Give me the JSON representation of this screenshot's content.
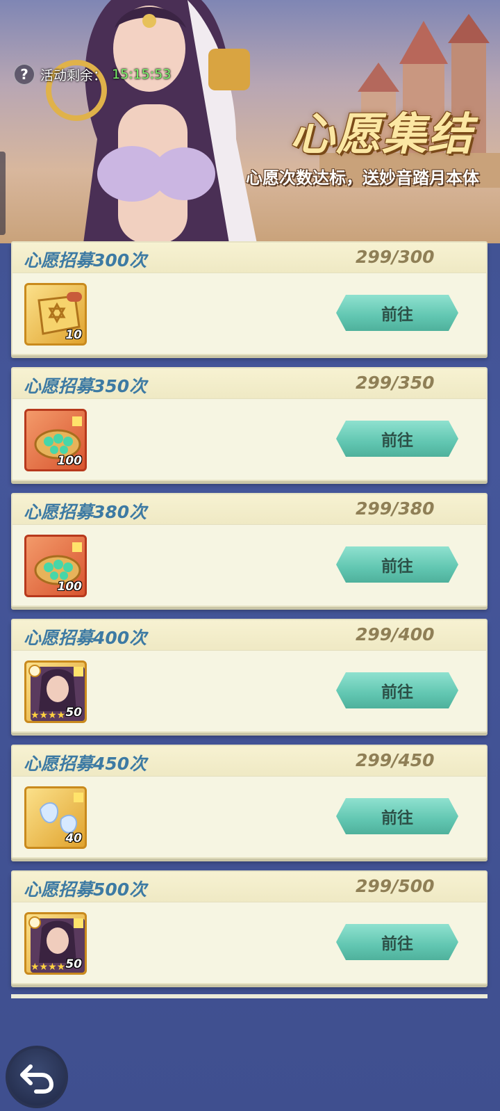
{
  "banner": {
    "timer_label": "活动剩余：",
    "timer_value": "15:15:53",
    "title": "心愿集结",
    "subtitle": "心愿次数达标，送妙音踏月本体"
  },
  "tasks": [
    {
      "name": "心愿招募300次",
      "progress": "299/300",
      "reward_icon": "scroll-icon",
      "quantity": "10",
      "button": "前往"
    },
    {
      "name": "心愿招募350次",
      "progress": "299/350",
      "reward_icon": "jade-gem-icon",
      "quantity": "100",
      "button": "前往"
    },
    {
      "name": "心愿招募380次",
      "progress": "299/380",
      "reward_icon": "jade-gem-icon",
      "quantity": "100",
      "button": "前往"
    },
    {
      "name": "心愿招募400次",
      "progress": "299/400",
      "reward_icon": "hero-shard-icon",
      "quantity": "50",
      "button": "前往"
    },
    {
      "name": "心愿招募450次",
      "progress": "299/450",
      "reward_icon": "crystal-icon",
      "quantity": "40",
      "button": "前往"
    },
    {
      "name": "心愿招募500次",
      "progress": "299/500",
      "reward_icon": "hero-shard-icon",
      "quantity": "50",
      "button": "前往"
    }
  ],
  "colors": {
    "task_name": "#3d7aa3",
    "progress": "#8f7f56",
    "button": "#61c6b1",
    "timer": "#7af46b",
    "title": "#fbe7a3"
  }
}
